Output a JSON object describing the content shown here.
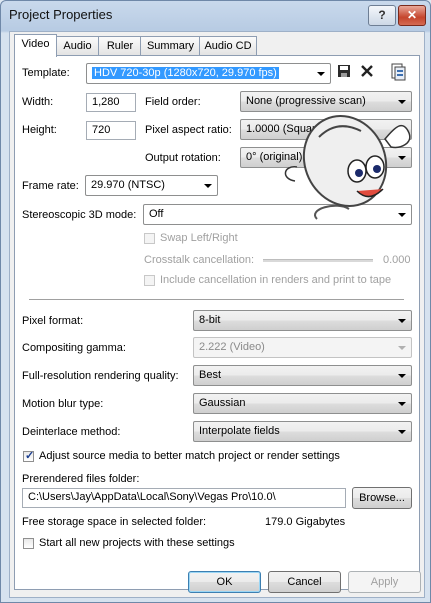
{
  "window": {
    "title": "Project Properties",
    "help_button": "?",
    "close_button": "✕"
  },
  "tabs": [
    "Video",
    "Audio",
    "Ruler",
    "Summary",
    "Audio CD"
  ],
  "video": {
    "template_label": "Template:",
    "template_value": "HDV 720-30p (1280x720, 29.970 fps)",
    "width_label": "Width:",
    "width_value": "1,280",
    "height_label": "Height:",
    "height_value": "720",
    "field_order_label": "Field order:",
    "field_order_value": "None (progressive scan)",
    "pixel_aspect_label": "Pixel aspect ratio:",
    "pixel_aspect_value": "1.0000 (Square)",
    "output_rotation_label": "Output rotation:",
    "output_rotation_value": "0° (original)",
    "frame_rate_label": "Frame rate:",
    "frame_rate_value": "29.970 (NTSC)",
    "stereo_label": "Stereoscopic 3D mode:",
    "stereo_value": "Off",
    "swap_label": "Swap Left/Right",
    "crosstalk_label": "Crosstalk cancellation:",
    "crosstalk_value": "0.000",
    "include_cancel_label": "Include cancellation in renders and print to tape",
    "pixel_format_label": "Pixel format:",
    "pixel_format_value": "8-bit",
    "gamma_label": "Compositing gamma:",
    "gamma_value": "2.222 (Video)",
    "quality_label": "Full-resolution rendering quality:",
    "quality_value": "Best",
    "motion_blur_label": "Motion blur type:",
    "motion_blur_value": "Gaussian",
    "deinterlace_label": "Deinterlace method:",
    "deinterlace_value": "Interpolate fields",
    "adjust_label": "Adjust source media to better match project or render settings",
    "adjust_checked": true,
    "prerender_label": "Prerendered files folder:",
    "prerender_value": "C:\\Users\\Jay\\AppData\\Local\\Sony\\Vegas Pro\\10.0\\",
    "browse_label": "Browse...",
    "free_storage_label": "Free storage space in selected folder:",
    "free_storage_value": "179.0 Gigabytes",
    "start_all_label": "Start all new projects with these settings"
  },
  "buttons": {
    "ok": "OK",
    "cancel": "Cancel",
    "apply": "Apply"
  },
  "icons": {
    "save": "save-icon",
    "delete": "delete-icon",
    "match_media": "match-media-icon",
    "mascot": "mouse-mascot-icon"
  },
  "colors": {
    "selection": "#3399ff",
    "accent": "#3c7fb1"
  }
}
